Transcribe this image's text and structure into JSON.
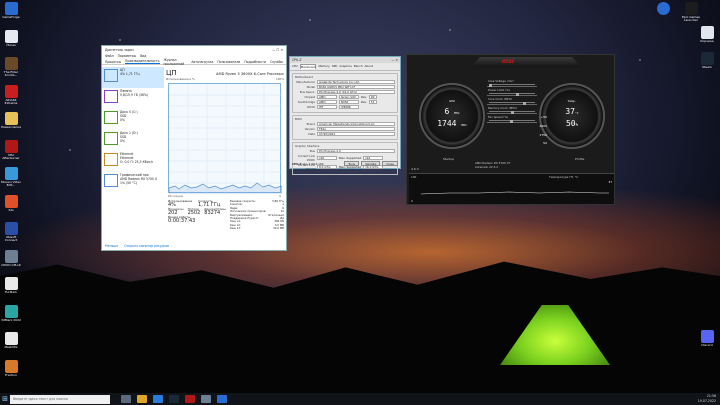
{
  "desktop_left": [
    {
      "label": "GameForge",
      "color": "#2a6bd1"
    },
    {
      "label": "iTunes",
      "color": "#e8e8f0"
    },
    {
      "label": "The Elder Scrolls...",
      "color": "#6b4a2a"
    },
    {
      "label": "AIDA64 Extreme",
      "color": "#c81e1e"
    },
    {
      "label": "Новая папка",
      "color": "#e6c15a"
    },
    {
      "label": "MSI Afterburner",
      "color": "#b01818"
    },
    {
      "label": "Movavi Video Edit...",
      "color": "#3a9ad9"
    },
    {
      "label": "3ds",
      "color": "#e0512a"
    },
    {
      "label": "Ubisoft Connect",
      "color": "#2b4fa8"
    },
    {
      "label": "CPUID CPU-Z",
      "color": "#6d7f92"
    },
    {
      "label": "FurMark",
      "color": "#e8e8e8"
    },
    {
      "label": "3dMark 2022",
      "color": "#2aa6a6"
    },
    {
      "label": "MeshMix",
      "color": "#e9e9e9"
    },
    {
      "label": "Fraction",
      "color": "#d67a2a"
    }
  ],
  "desktop_right": [
    {
      "label": "Epic Games Launcher",
      "color": "#1c1c1c"
    },
    {
      "label": "Корзина",
      "color": "#dfe6ee"
    },
    {
      "label": "Steam",
      "color": "#1b2838"
    },
    {
      "label": "Discord",
      "color": "#5865f2"
    }
  ],
  "taskbar": {
    "search": "Введите здесь текст для поиска",
    "time": "21:56",
    "date": "19.07.2022"
  },
  "task_manager": {
    "title": "Диспетчер задач",
    "menu": [
      "Файл",
      "Параметры",
      "Вид"
    ],
    "tabs": [
      "Процессы",
      "Производительность",
      "Журнал приложений",
      "Автозагрузка",
      "Пользователи",
      "Подробности",
      "Службы"
    ],
    "side": [
      {
        "name": "ЦП",
        "sub": "4% 1,71 ГГц",
        "color": "#4f8ed3"
      },
      {
        "name": "Память",
        "sub": "5,8/15,9 ГБ (36%)",
        "color": "#8b3fc1"
      },
      {
        "name": "Диск 0 (C:)",
        "sub": "SSD",
        "sub2": "0%",
        "color": "#4c9a2a"
      },
      {
        "name": "Диск 1 (D:)",
        "sub": "SSD",
        "sub2": "0%",
        "color": "#4c9a2a"
      },
      {
        "name": "Ethernet",
        "sub": "Ethernet",
        "sub2": "О: 0,0 П: 25,5 Кбит/с",
        "color": "#c28a22"
      },
      {
        "name": "Графический про",
        "sub": "AMD Radeon RX 5700 X",
        "sub2": "1% (50 °C)",
        "color": "#4f8ed3"
      }
    ],
    "heading": "ЦП",
    "cpu_name": "AMD Ryzen 5 3600X 6-Core Processor",
    "graph_top": "Использование в %",
    "graph_right": "100%",
    "graph_left": "60 секунд",
    "graph_zero": "0",
    "stats": {
      "util_label": "Использование",
      "util": "4%",
      "speed_label": "Скорость",
      "speed": "1,71 ГГц",
      "proc_label": "Процессы",
      "proc": "202",
      "threads_label": "Потоки",
      "threads": "2502",
      "handles_label": "Дескрипторы",
      "handles": "83274",
      "uptime_label": "Время работы",
      "uptime": "0:00:37:43",
      "details": [
        [
          "Базовая скорость:",
          "3,80 ГГц"
        ],
        [
          "Сокетов:",
          "1"
        ],
        [
          "Ядра:",
          "6"
        ],
        [
          "Логических процессоров:",
          "12"
        ],
        [
          "Виртуализация:",
          "Отключено"
        ],
        [
          "Поддержка Hyper-V:",
          "Да"
        ],
        [
          "Кэш L1:",
          "384 КБ"
        ],
        [
          "Кэш L2:",
          "3,0 МБ"
        ],
        [
          "Кэш L3:",
          "32,0 МБ"
        ]
      ]
    },
    "footer_less": "Меньше",
    "footer_link": "Открыть монитор ресурсов"
  },
  "cpuz": {
    "title": "CPU-Z",
    "tabs": [
      "CPU",
      "Mainboard",
      "Memory",
      "SPD",
      "Graphics",
      "Bench",
      "About"
    ],
    "active_tab": "Mainboard",
    "motherboard": {
      "legend": "Motherboard",
      "rows": [
        [
          "Manufacturer",
          "Gigabyte Technology Co. Ltd."
        ],
        [
          "Model",
          "B450 AORUS PRO WIFI-CF"
        ],
        [
          "Bus Specs.",
          "PCI-Express 4.0 (16.0 GT/s)"
        ]
      ],
      "chipset": [
        "Chipset",
        "AMD",
        "Ryzen SOC",
        "Rev.",
        "00"
      ],
      "southbridge": [
        "Southbridge",
        "AMD",
        "B450",
        "Rev.",
        "51"
      ],
      "lpcio": [
        "LPCIO",
        "ITE",
        "IT8686"
      ]
    },
    "bios": {
      "legend": "BIOS",
      "rows": [
        [
          "Brand",
          "American Megatrends International LLC."
        ],
        [
          "Version",
          "F62a"
        ],
        [
          "Date",
          "07/26/2022"
        ]
      ]
    },
    "gi": {
      "legend": "Graphic Interface",
      "rows": [
        [
          "Bus",
          "PCI-Express 4.0"
        ],
        [
          "Current Link Width",
          "x16",
          "Max. Supported",
          "x16"
        ],
        [
          "Current Link Speed",
          "8.0 GT/s",
          "Max. Supported",
          "16.0 GT/s"
        ]
      ]
    },
    "footer": {
      "brand": "CPU-Z",
      "ver": "Ver. 2.00.0.x64",
      "tools": "Tools",
      "validate": "Validate",
      "close": "Close"
    }
  },
  "afterburner": {
    "logo": "msi",
    "left_gauge": {
      "value": "6",
      "unit": "MHz",
      "value2": "1744",
      "unit2": "MHz",
      "label": "GPU"
    },
    "right_gauge": {
      "value": "37",
      "unit": "°C",
      "value2": "50",
      "unit2": "%",
      "label": "Temp."
    },
    "sliders": [
      {
        "label": "Core Voltage (mV)",
        "level": 0.0
      },
      {
        "label": "Power Limit (%)",
        "level": 0.62
      },
      {
        "label": "Core Clock (MHz)",
        "level": 0.78
      },
      {
        "label": "Memory Clock (MHz)",
        "level": 0.52
      },
      {
        "label": "Fan Speed (%)",
        "level": 0.48
      }
    ],
    "slider_values": {
      "power": "+50",
      "core": "2005",
      "memory": "1750",
      "fan": "50"
    },
    "version": "4.6.3",
    "startup": "Startup",
    "profile": "Profile",
    "gpu_info": "AMD Radeon RX 5700 XT",
    "driver": "Adrenalin 22.5.2",
    "graph_label": "Температура ГП, °С",
    "graph_max": "100",
    "graph_min": "0",
    "graph_val": "37"
  }
}
